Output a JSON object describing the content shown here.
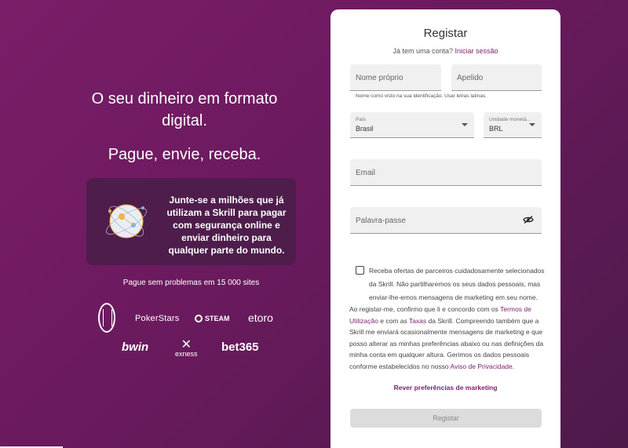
{
  "hero": {
    "headline": "O seu dinheiro em formato digital.",
    "subline": "Pague, envie, receba.",
    "promo": "Junte-se a milhões que já utilizam a Skrill para pagar com segurança online e enviar dinheiro para qualquer parte do mundo.",
    "partners_caption": "Pague sem problemas em 15 000 sites"
  },
  "partners": {
    "pokerstars": "PokerStars",
    "steam": "STEAM",
    "etoro": "etoro",
    "bwin": "bwin",
    "exness": "exness",
    "bet365": "bet365"
  },
  "form": {
    "title": "Registar",
    "login_prompt": "Já tem uma conta?",
    "login_link": "Iniciar sessão",
    "first_name_placeholder": "Nome próprio",
    "last_name_placeholder": "Apelido",
    "name_hint": "Nome como visto na sua identificação. Usar letras latinas.",
    "country_label": "País",
    "country_value": "Brasil",
    "currency_label": "Unidade monetá...",
    "currency_value": "BRL",
    "email_placeholder": "Email",
    "password_placeholder": "Palavra-passe",
    "offers_text": "Receba ofertas de parceiros cuidadosamente selecionados da Skrill. Não partilharemos os seus dados pessoais, mas enviar-lhe-emos mensagens de marketing em seu nome.",
    "legal_part1": "Ao registar-me, confirmo que li e concordo com os ",
    "legal_terms_link": "Termos de Utilização",
    "legal_part2": " e com as ",
    "legal_fees_link": "Taxas",
    "legal_part3": " da Skrill. Compreendo também que a Skrill me enviará ocasionalmente mensagens de marketing e que posso alterar as minhas preferências abaixo ou nas definições da minha conta em qualquer altura. Gerimos os dados pessoais conforme estabelecidos no nosso ",
    "legal_privacy_link": "Aviso de Privacidade",
    "legal_part4": ".",
    "marketing_prefs": "Rever preferências de marketing",
    "submit": "Registar"
  },
  "colors": {
    "brand": "#7b1e6a",
    "background_start": "#7a1d68",
    "background_end": "#4d1a4a",
    "promo_bg": "#4e1d4c"
  }
}
